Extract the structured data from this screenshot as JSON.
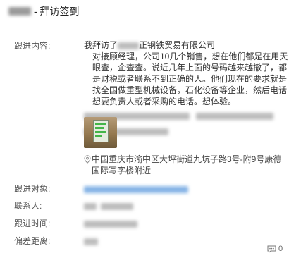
{
  "header": {
    "title": "- 拜访签到"
  },
  "followup_content": {
    "label": "跟进内容:",
    "line1_pre": "我拜访了",
    "line1_post": "正钢铁贸易有限公司",
    "body1": "对接顾经理，公司10几个销售，想在他们都是在用天眼查，企查查。说近几年上面的号码越来越撤了，都是财税或者联系不到正确的人。他们现在的要求就是找全国做重型机械设备，石化设备等企业，然后电话想要负责人或者采购的电话。想体验。"
  },
  "location": {
    "icon": "map-pin-icon",
    "address": "中国重庆市渝中区大坪街道九坑子路3号-附9号康德国际写字楼附近"
  },
  "fields": {
    "target_label": "跟进对象:",
    "contact_label": "联系人:",
    "time_label": "跟进时间:",
    "distance_label": "偏差距离:"
  },
  "footer": {
    "comment_count": "0"
  }
}
